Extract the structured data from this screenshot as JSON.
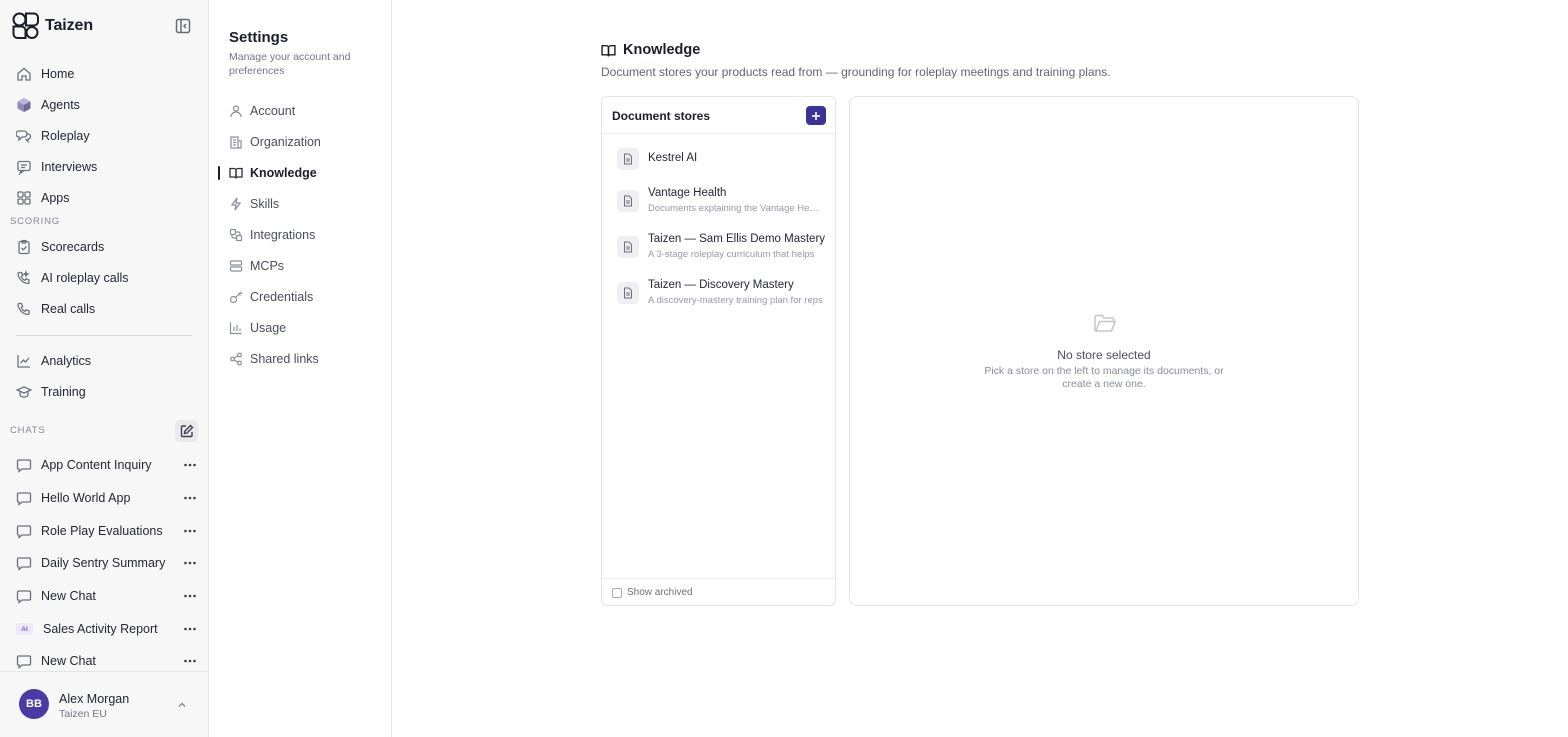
{
  "sidebar": {
    "brand": "Taizen",
    "nav": [
      {
        "label": "Home",
        "icon": "home-icon"
      },
      {
        "label": "Agents",
        "icon": "cube-icon"
      },
      {
        "label": "Roleplay",
        "icon": "roleplay-icon"
      },
      {
        "label": "Interviews",
        "icon": "interviews-icon"
      },
      {
        "label": "Apps",
        "icon": "apps-icon"
      }
    ],
    "scoring_label": "SCORING",
    "scoring": [
      {
        "label": "Scorecards",
        "icon": "clipboard-icon"
      },
      {
        "label": "AI roleplay calls",
        "icon": "phone-ai-icon"
      },
      {
        "label": "Real calls",
        "icon": "phone-icon"
      }
    ],
    "extra": [
      {
        "label": "Analytics",
        "icon": "analytics-icon"
      },
      {
        "label": "Training",
        "icon": "graduation-cap-icon"
      }
    ],
    "chats_label": "CHATS",
    "chats": [
      {
        "label": "App Content Inquiry",
        "ai": false
      },
      {
        "label": "Hello World App",
        "ai": false
      },
      {
        "label": "Role Play Evaluations",
        "ai": false
      },
      {
        "label": "Daily Sentry Summary",
        "ai": false
      },
      {
        "label": "New Chat",
        "ai": false
      },
      {
        "label": "Sales Activity Report",
        "ai": true,
        "badge": "AI"
      },
      {
        "label": "New Chat",
        "ai": false
      }
    ],
    "user": {
      "initials": "BB",
      "name": "Alex Morgan",
      "org": "Taizen EU"
    }
  },
  "settings": {
    "title": "Settings",
    "subtitle": "Manage your account and preferences",
    "items": [
      {
        "label": "Account",
        "icon": "user-icon"
      },
      {
        "label": "Organization",
        "icon": "building-icon"
      },
      {
        "label": "Knowledge",
        "icon": "book-icon",
        "active": true
      },
      {
        "label": "Skills",
        "icon": "bolt-icon"
      },
      {
        "label": "Integrations",
        "icon": "integrations-icon"
      },
      {
        "label": "MCPs",
        "icon": "server-icon"
      },
      {
        "label": "Credentials",
        "icon": "key-icon"
      },
      {
        "label": "Usage",
        "icon": "bar-chart-icon"
      },
      {
        "label": "Shared links",
        "icon": "share-icon"
      }
    ]
  },
  "main": {
    "title": "Knowledge",
    "description": "Document stores your products read from — grounding for roleplay meetings and training plans.",
    "stores_title": "Document stores",
    "stores": [
      {
        "name": "Kestrel AI",
        "desc": ""
      },
      {
        "name": "Vantage Health",
        "desc": "Documents explaining the Vantage Health"
      },
      {
        "name": "Taizen — Sam Ellis Demo Mastery",
        "desc": "A 3-stage roleplay curriculum that helps"
      },
      {
        "name": "Taizen — Discovery Mastery",
        "desc": "A discovery-mastery training plan for reps"
      }
    ],
    "show_archived": "Show archived",
    "empty_title": "No store selected",
    "empty_text": "Pick a store on the left to manage its documents, or create a new one."
  },
  "colors": {
    "accent": "#3b3394",
    "avatar": "#4b3aa6"
  }
}
